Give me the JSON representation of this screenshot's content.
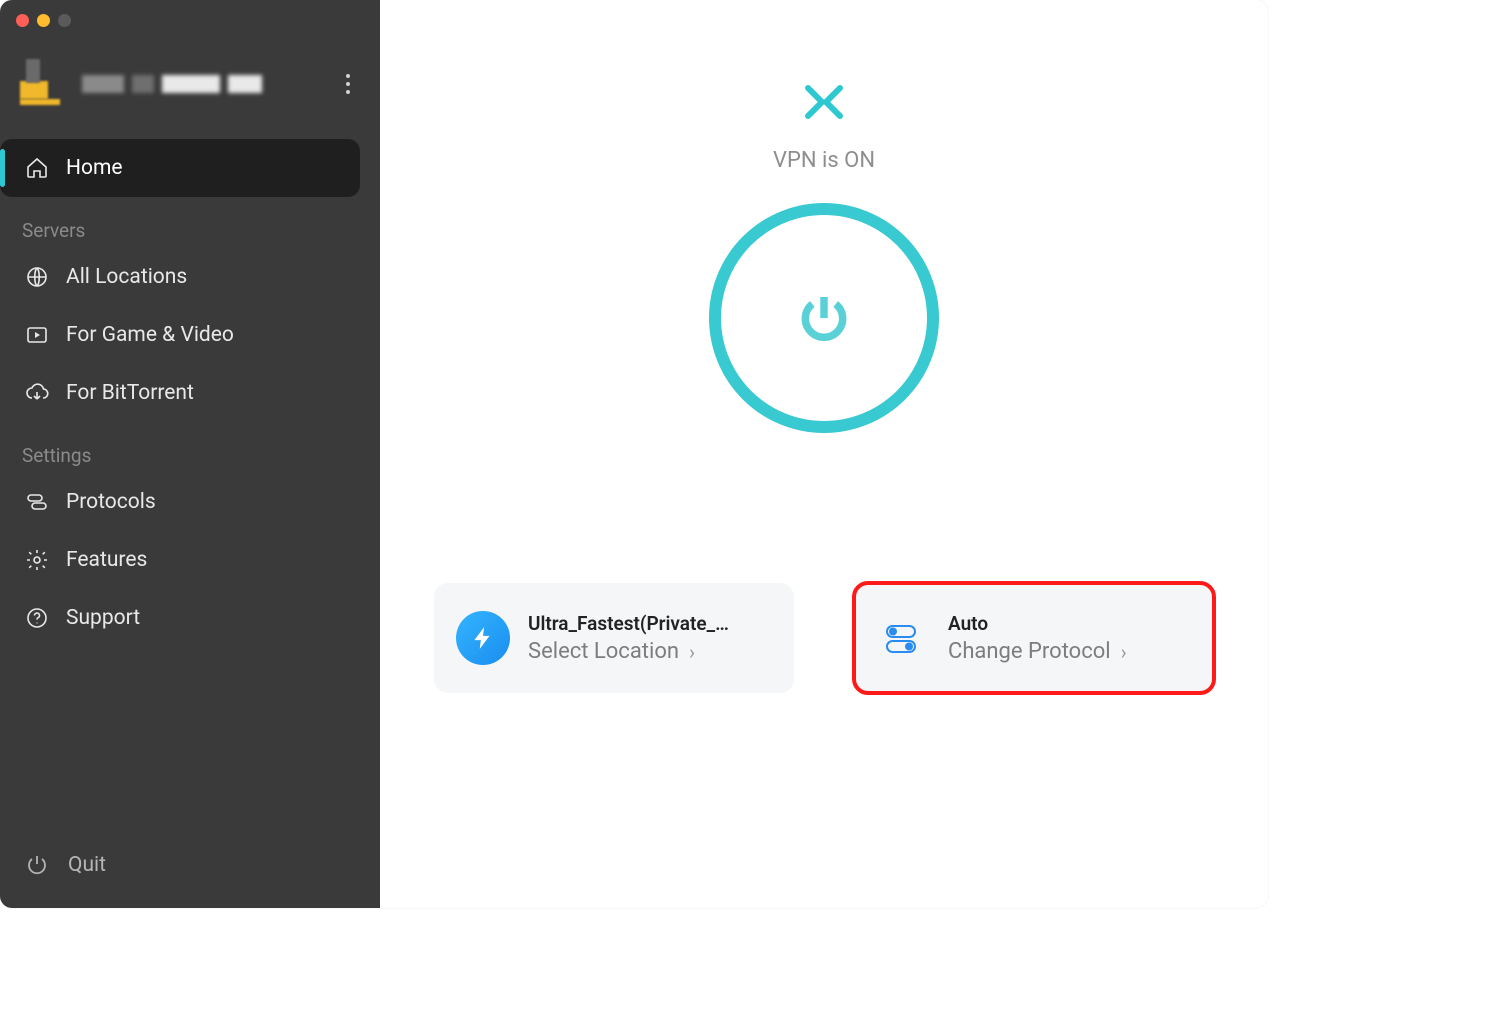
{
  "sidebar": {
    "nav": {
      "home": "Home"
    },
    "sections": {
      "servers_label": "Servers",
      "servers": [
        {
          "label": "All Locations"
        },
        {
          "label": "For Game & Video"
        },
        {
          "label": "For BitTorrent"
        }
      ],
      "settings_label": "Settings",
      "settings": [
        {
          "label": "Protocols"
        },
        {
          "label": "Features"
        },
        {
          "label": "Support"
        }
      ]
    },
    "quit_label": "Quit"
  },
  "main": {
    "status_text": "VPN is ON",
    "location_card": {
      "title": "Ultra_Fastest(Private_…",
      "subtitle": "Select Location"
    },
    "protocol_card": {
      "title": "Auto",
      "subtitle": "Change Protocol"
    }
  },
  "colors": {
    "accent": "#2ec9d0",
    "annotation": "#ff1a1a"
  }
}
